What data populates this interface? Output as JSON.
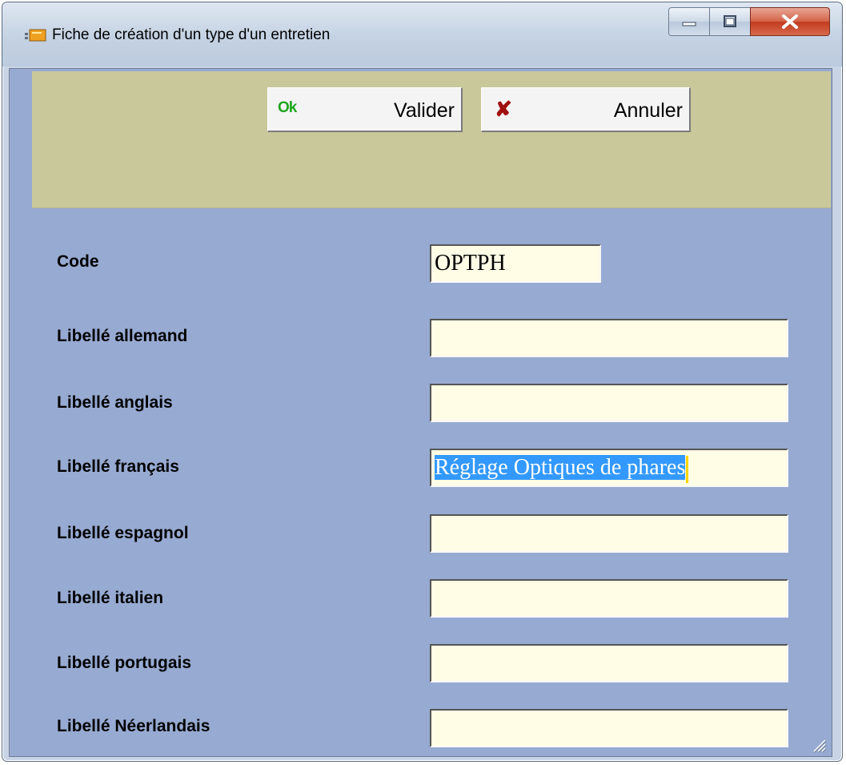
{
  "window": {
    "title": "Fiche de création d'un type d'un entretien",
    "app_icon": "form-icon",
    "controls": [
      "minimize-icon",
      "maximize-icon",
      "close-icon"
    ]
  },
  "toolbar": {
    "valider": {
      "icon_text": "Ok",
      "label": "Valider"
    },
    "annuler": {
      "icon": "x-mark-icon",
      "label": "Annuler"
    }
  },
  "form": {
    "fields": [
      {
        "label": "Code",
        "value": "OPTPH"
      },
      {
        "label": "Libellé allemand",
        "value": ""
      },
      {
        "label": "Libellé anglais",
        "value": ""
      },
      {
        "label": "Libellé français",
        "value": "Réglage Optiques de phares",
        "selected": true
      },
      {
        "label": "Libellé espagnol",
        "value": ""
      },
      {
        "label": "Libellé italien",
        "value": ""
      },
      {
        "label": "Libellé portugais",
        "value": ""
      },
      {
        "label": "Libellé Néerlandais",
        "value": ""
      }
    ]
  },
  "colors": {
    "client_bg": "#97aad2",
    "toolbar_bg": "#c9c89b",
    "field_bg": "#fffde6",
    "selection": "#3399ff",
    "ok_green": "#1fa61f",
    "x_red": "#a01010"
  }
}
